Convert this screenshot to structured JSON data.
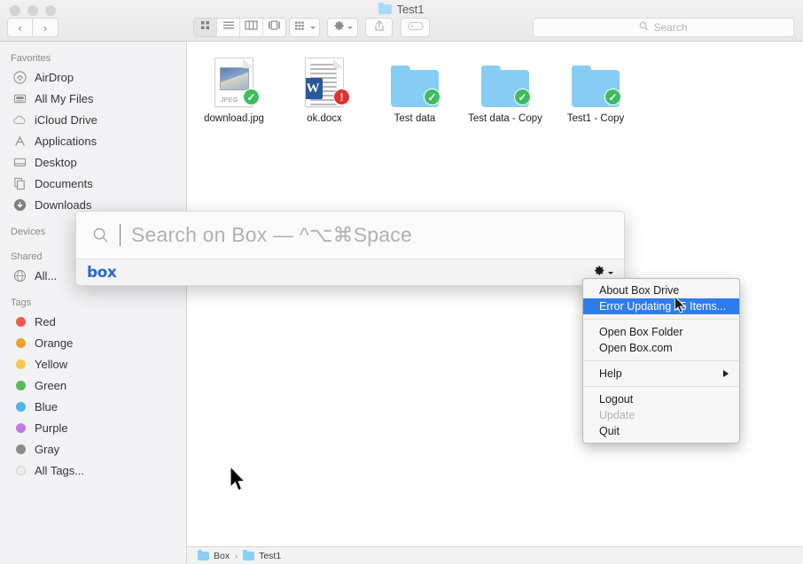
{
  "window": {
    "title": "Test1",
    "title_icon": "folder-icon",
    "nav_back": "‹",
    "nav_forward": "›"
  },
  "toolbar": {
    "view_icon_label": "icon-view",
    "view_list_label": "list-view",
    "view_column_label": "column-view",
    "view_gallery_label": "gallery-view",
    "arrange_label": "arrange-icon",
    "action_label": "gear-icon",
    "share_label": "share-icon",
    "tag_label": "tag-icon",
    "search_placeholder": "Search",
    "search_value": ""
  },
  "sidebar": {
    "sections": [
      {
        "header": "Favorites",
        "items": [
          {
            "label": "AirDrop",
            "icon": "airdrop-icon"
          },
          {
            "label": "All My Files",
            "icon": "all-my-files-icon"
          },
          {
            "label": "iCloud Drive",
            "icon": "icloud-icon"
          },
          {
            "label": "Applications",
            "icon": "applications-icon"
          },
          {
            "label": "Desktop",
            "icon": "desktop-icon"
          },
          {
            "label": "Documents",
            "icon": "documents-icon"
          },
          {
            "label": "Downloads",
            "icon": "downloads-icon"
          }
        ]
      },
      {
        "header": "Devices",
        "items": []
      },
      {
        "header": "Shared",
        "items": [
          {
            "label": "All...",
            "icon": "network-icon"
          }
        ]
      },
      {
        "header": "Tags",
        "items": [
          {
            "label": "Red",
            "icon": "tag-dot",
            "color": "#f2594b"
          },
          {
            "label": "Orange",
            "icon": "tag-dot",
            "color": "#f0a030"
          },
          {
            "label": "Yellow",
            "icon": "tag-dot",
            "color": "#f7c948"
          },
          {
            "label": "Green",
            "icon": "tag-dot",
            "color": "#5cb85c"
          },
          {
            "label": "Blue",
            "icon": "tag-dot",
            "color": "#52b0ea"
          },
          {
            "label": "Purple",
            "icon": "tag-dot",
            "color": "#c27ae0"
          },
          {
            "label": "Gray",
            "icon": "tag-dot",
            "color": "#8c8c8c"
          },
          {
            "label": "All Tags...",
            "icon": "tag-dot",
            "color": "#e8e8e8"
          }
        ]
      }
    ]
  },
  "files": [
    {
      "name": "download.jpg",
      "kind": "jpeg-file",
      "type_text": "JPEG",
      "badge": "ok"
    },
    {
      "name": "ok.docx",
      "kind": "word-file",
      "badge": "error"
    },
    {
      "name": "Test data",
      "kind": "folder",
      "badge": "ok"
    },
    {
      "name": "Test data - Copy",
      "kind": "folder",
      "badge": "ok"
    },
    {
      "name": "Test1 - Copy",
      "kind": "folder",
      "badge": "ok"
    }
  ],
  "breadcrumb": {
    "separator": "›",
    "items": [
      {
        "label": "Box"
      },
      {
        "label": "Test1"
      }
    ]
  },
  "box_overlay": {
    "search_placeholder": "Search on Box  —   ^⌥⌘Space",
    "search_value": "",
    "logo_text": "box",
    "gear_icon": "gear-icon"
  },
  "context_menu": {
    "items": [
      {
        "label": "About Box Drive",
        "state": "normal"
      },
      {
        "label": "Error Updating 15 Items...",
        "state": "selected"
      },
      {
        "label": "Open Box Folder",
        "state": "normal"
      },
      {
        "label": "Open Box.com",
        "state": "normal"
      },
      {
        "label": "Help",
        "state": "submenu"
      },
      {
        "label": "Logout",
        "state": "normal"
      },
      {
        "label": "Update",
        "state": "disabled"
      },
      {
        "label": "Quit",
        "state": "normal"
      }
    ]
  },
  "colors": {
    "accent": "#2f7ced",
    "box_blue": "#2a67d4",
    "ok_green": "#3dbd5f",
    "error_red": "#e03131",
    "folder_blue": "#86cdf3"
  }
}
